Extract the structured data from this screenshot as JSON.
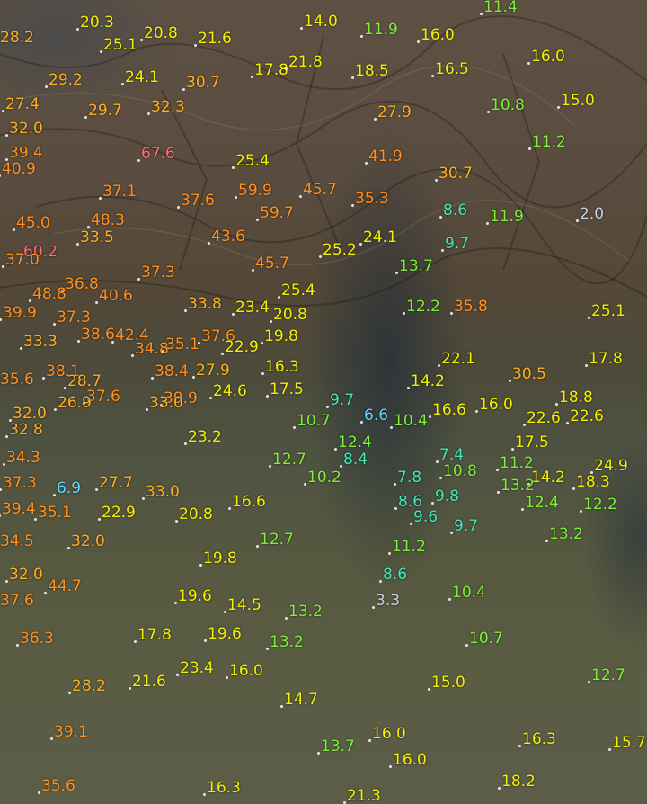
{
  "colors": {
    "very_low": "#c8d0e8",
    "low": "#5fd8ff",
    "cool": "#40e8b8",
    "mild": "#7ef03a",
    "medium": "#f4f000",
    "warm": "#ffb020",
    "hot": "#ff9020",
    "extreme": "#ff6a6a"
  },
  "stations": [
    "20.3",
    "28.2",
    "25.1",
    "20.8",
    "21.6",
    "14.0",
    "11.9",
    "16.0",
    "11.4",
    "16.0",
    "29.2",
    "24.1",
    "30.7",
    "17.8",
    "21.8",
    "18.5",
    "16.5",
    "27.4",
    "29.7",
    "32.3",
    "27.9",
    "10.8",
    "15.0",
    "32.0",
    "11.2",
    "39.4",
    "67.6",
    "40.9",
    "25.4",
    "41.9",
    "30.7",
    "37.1",
    "37.6",
    "59.9",
    "45.7",
    "35.3",
    "8.6",
    "11.9",
    "2.0",
    "45.0",
    "48.3",
    "59.7",
    "33.5",
    "43.6",
    "24.1",
    "25.2",
    "9.7",
    "60.2",
    "37.0",
    "45.7",
    "13.7",
    "37.3",
    "36.8",
    "48.8",
    "40.6",
    "25.4",
    "39.9",
    "37.3",
    "33.8",
    "23.4",
    "20.8",
    "12.2",
    "35.8",
    "25.1",
    "38.6",
    "42.4",
    "37.6",
    "19.8",
    "33.3",
    "34.8",
    "35.1",
    "22.9",
    "22.1",
    "17.8",
    "35.6",
    "38.1",
    "28.7",
    "38.4",
    "27.9",
    "16.3",
    "30.5",
    "14.2",
    "17.5",
    "18.8",
    "37.6",
    "39.9",
    "24.6",
    "26.9",
    "33.0",
    "9.7",
    "16.6",
    "16.0",
    "10.7",
    "6.6",
    "10.4",
    "22.6",
    "22.6",
    "32.0",
    "32.8",
    "23.2",
    "12.4",
    "17.5",
    "34.3",
    "12.7",
    "8.4",
    "7.4",
    "10.8",
    "11.2",
    "14.2",
    "24.9",
    "18.3",
    "10.2",
    "7.8",
    "13.2",
    "37.3",
    "6.9",
    "27.7",
    "33.0",
    "9.8",
    "12.4",
    "12.2",
    "39.4",
    "35.1",
    "22.9",
    "20.8",
    "16.6",
    "8.6",
    "9.6",
    "9.7",
    "13.2",
    "34.5",
    "32.0",
    "12.7",
    "11.2",
    "19.8",
    "32.0",
    "8.6",
    "44.7",
    "10.4",
    "37.6",
    "19.6",
    "14.5",
    "13.2",
    "3.3",
    "36.3",
    "17.8",
    "19.6",
    "13.2",
    "10.7",
    "23.4",
    "16.0",
    "28.2",
    "21.6",
    "12.7",
    "15.0",
    "14.7",
    "39.1",
    "16.0",
    "16.3",
    "15.7",
    "13.7",
    "16.0",
    "35.6",
    "16.3",
    "18.2",
    "21.3"
  ]
}
